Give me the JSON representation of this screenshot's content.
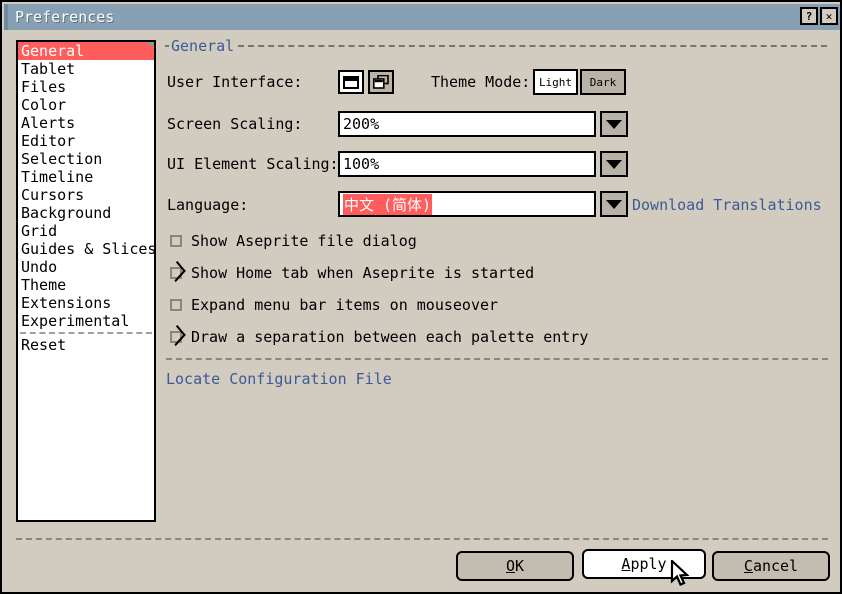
{
  "window": {
    "title": "Preferences",
    "titlebar_buttons": [
      {
        "name": "help-button",
        "glyph": "?"
      },
      {
        "name": "close-button",
        "glyph": "✕"
      }
    ]
  },
  "sidebar": {
    "items": [
      {
        "label": "General",
        "selected": true
      },
      {
        "label": "Tablet",
        "selected": false
      },
      {
        "label": "Files",
        "selected": false
      },
      {
        "label": "Color",
        "selected": false
      },
      {
        "label": "Alerts",
        "selected": false
      },
      {
        "label": "Editor",
        "selected": false
      },
      {
        "label": "Selection",
        "selected": false
      },
      {
        "label": "Timeline",
        "selected": false
      },
      {
        "label": "Cursors",
        "selected": false
      },
      {
        "label": "Background",
        "selected": false
      },
      {
        "label": "Grid",
        "selected": false
      },
      {
        "label": "Guides & Slices",
        "selected": false
      },
      {
        "label": "Undo",
        "selected": false
      },
      {
        "label": "Theme",
        "selected": false
      },
      {
        "label": "Extensions",
        "selected": false
      },
      {
        "label": "Experimental",
        "selected": false
      }
    ],
    "footer_items": [
      {
        "label": "Reset",
        "selected": false
      }
    ]
  },
  "main": {
    "group_title": "General",
    "user_interface": {
      "label": "User Interface:",
      "options": [
        {
          "name": "single-window-icon",
          "selected": true
        },
        {
          "name": "multiple-windows-icon",
          "selected": false
        }
      ]
    },
    "theme_mode": {
      "label": "Theme Mode:",
      "options": [
        {
          "label": "Light",
          "selected": true
        },
        {
          "label": "Dark",
          "selected": false
        }
      ]
    },
    "screen_scaling": {
      "label": "Screen Scaling:",
      "value": "200%"
    },
    "ui_element_scaling": {
      "label": "UI Element Scaling:",
      "value": "100%"
    },
    "language": {
      "label": "Language:",
      "value": "中文 (简体)",
      "download_link": "Download Translations"
    },
    "checkboxes": [
      {
        "label": "Show Aseprite file dialog",
        "checked": false
      },
      {
        "label": "Show Home tab when Aseprite is started",
        "checked": true
      },
      {
        "label": "Expand menu bar items on mouseover",
        "checked": false
      },
      {
        "label": "Draw a separation between each palette entry",
        "checked": true
      }
    ],
    "locate_config_link": "Locate Configuration File"
  },
  "footer": {
    "buttons": [
      {
        "label": "OK",
        "accel": "O",
        "state": "normal"
      },
      {
        "label": "Apply",
        "accel": "A",
        "state": "hot"
      },
      {
        "label": "Cancel",
        "accel": "C",
        "state": "normal"
      }
    ]
  },
  "colors": {
    "window_bg": "#d2cbbf",
    "titlebar": "#87a0b4",
    "selection": "#ff5c5c",
    "link": "#3b5a96",
    "button_face": "#c3bcb1"
  }
}
